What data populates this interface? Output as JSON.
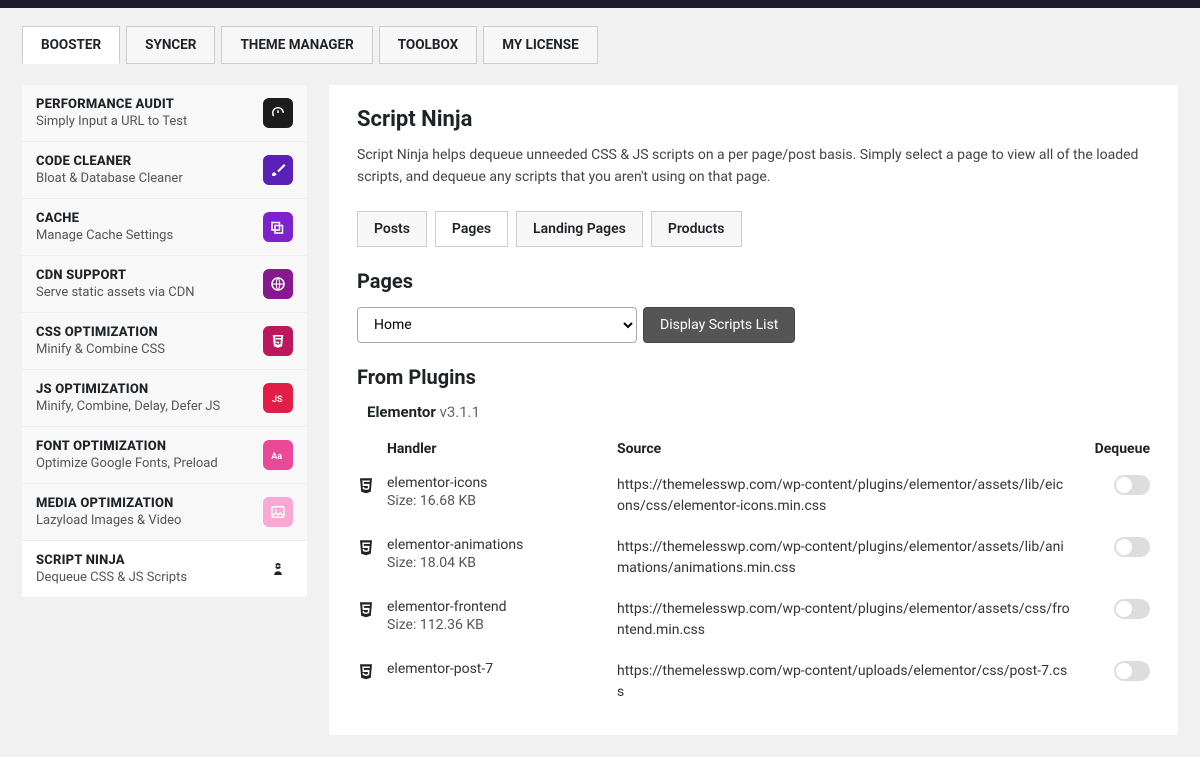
{
  "top_tabs": [
    "BOOSTER",
    "SYNCER",
    "THEME MANAGER",
    "TOOLBOX",
    "MY LICENSE"
  ],
  "sidebar": [
    {
      "title": "PERFORMANCE AUDIT",
      "sub": "Simply Input a URL to Test",
      "color": "#1d1d1d",
      "icon": "gauge"
    },
    {
      "title": "CODE CLEANER",
      "sub": "Bloat & Database Cleaner",
      "color": "#5b21b6",
      "icon": "brush"
    },
    {
      "title": "CACHE",
      "sub": "Manage Cache Settings",
      "color": "#7e22ce",
      "icon": "layers"
    },
    {
      "title": "CDN SUPPORT",
      "sub": "Serve static assets via CDN",
      "color": "#86198f",
      "icon": "globe"
    },
    {
      "title": "CSS OPTIMIZATION",
      "sub": "Minify & Combine CSS",
      "color": "#be185d",
      "icon": "css"
    },
    {
      "title": "JS OPTIMIZATION",
      "sub": "Minify, Combine, Delay, Defer JS",
      "color": "#e11d48",
      "icon": "js"
    },
    {
      "title": "FONT OPTIMIZATION",
      "sub": "Optimize Google Fonts, Preload",
      "color": "#ec4899",
      "icon": "font"
    },
    {
      "title": "MEDIA OPTIMIZATION",
      "sub": "Lazyload Images & Video",
      "color": "#f9a8d4",
      "icon": "image"
    },
    {
      "title": "SCRIPT NINJA",
      "sub": "Dequeue CSS & JS Scripts",
      "color": "#fff",
      "icon": "ninja"
    }
  ],
  "main": {
    "title": "Script Ninja",
    "desc": "Script Ninja helps dequeue unneeded CSS & JS scripts on a per page/post basis. Simply select a page to view all of the loaded scripts, and dequeue any scripts that you aren't using on that page.",
    "sub_tabs": [
      "Posts",
      "Pages",
      "Landing Pages",
      "Products"
    ],
    "section": "Pages",
    "page_select": "Home",
    "display_btn": "Display Scripts List",
    "from_plugins": "From Plugins",
    "plugin_name": "Elementor",
    "plugin_ver": "v3.1.1",
    "cols": {
      "handler": "Handler",
      "source": "Source",
      "dequeue": "Dequeue"
    },
    "rows": [
      {
        "name": "elementor-icons",
        "size": "Size: 16.68 KB",
        "src": "https://themelesswp.com/wp-content/plugins/elementor/assets/lib/eicons/css/elementor-icons.min.css"
      },
      {
        "name": "elementor-animations",
        "size": "Size: 18.04 KB",
        "src": "https://themelesswp.com/wp-content/plugins/elementor/assets/lib/animations/animations.min.css"
      },
      {
        "name": "elementor-frontend",
        "size": "Size: 112.36 KB",
        "src": "https://themelesswp.com/wp-content/plugins/elementor/assets/css/frontend.min.css"
      },
      {
        "name": "elementor-post-7",
        "size": "",
        "src": "https://themelesswp.com/wp-content/uploads/elementor/css/post-7.css"
      }
    ]
  }
}
